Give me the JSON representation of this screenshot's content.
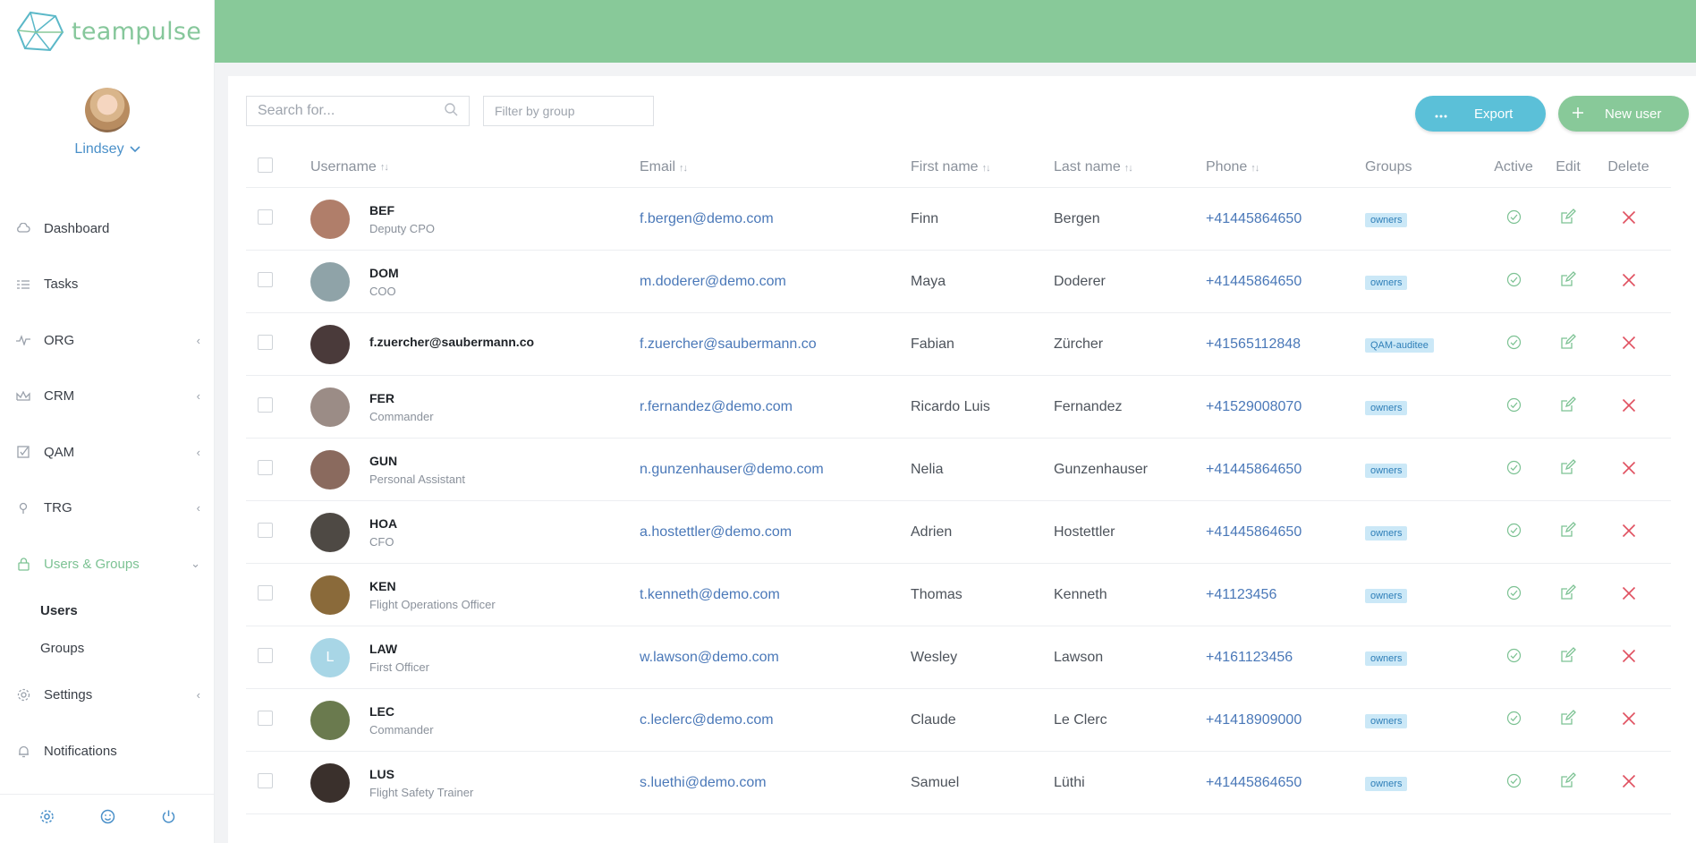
{
  "brand": {
    "name": "teampulse",
    "logo_icon": "hexagon-logo-icon"
  },
  "colors": {
    "header": "#88c999",
    "accent_green": "#7cc293",
    "link_blue": "#4a78b8",
    "export_button": "#5bc0d8",
    "delete_red": "#e05060",
    "badge_bg": "#cbe8f7"
  },
  "profile": {
    "name": "Lindsey"
  },
  "sidebar": {
    "items": [
      {
        "label": "Dashboard",
        "icon": "cloud-icon",
        "chevron": ""
      },
      {
        "label": "Tasks",
        "icon": "tasks-list-icon",
        "chevron": ""
      },
      {
        "label": "ORG",
        "icon": "pulse-icon",
        "chevron": "‹"
      },
      {
        "label": "CRM",
        "icon": "crown-icon",
        "chevron": "‹"
      },
      {
        "label": "QAM",
        "icon": "checkbox-icon",
        "chevron": "‹"
      },
      {
        "label": "TRG",
        "icon": "pin-icon",
        "chevron": "‹"
      },
      {
        "label": "Users & Groups",
        "icon": "lock-icon",
        "chevron": "⌄"
      }
    ],
    "subitems": [
      {
        "label": "Users"
      },
      {
        "label": "Groups"
      }
    ],
    "items_after": [
      {
        "label": "Settings",
        "icon": "gear-icon",
        "chevron": "‹"
      },
      {
        "label": "Notifications",
        "icon": "bell-icon",
        "chevron": ""
      }
    ],
    "footer_icons": [
      "settings-icon",
      "smiley-icon",
      "power-icon"
    ]
  },
  "toolbar": {
    "search_placeholder": "Search for...",
    "filter_placeholder": "Filter by group",
    "export_label": "Export",
    "new_user_label": "New user"
  },
  "table": {
    "headers": {
      "username": "Username",
      "email": "Email",
      "first_name": "First name",
      "last_name": "Last name",
      "phone": "Phone",
      "groups": "Groups",
      "active": "Active",
      "edit": "Edit",
      "delete": "Delete"
    },
    "rows": [
      {
        "abbr": "BEF",
        "role": "Deputy CPO",
        "email": "f.bergen@demo.com",
        "first": "Finn",
        "last": "Bergen",
        "phone": "+41445864650",
        "group": "owners",
        "avatar_color": "#b07e6a",
        "avatar_letter": ""
      },
      {
        "abbr": "DOM",
        "role": "COO",
        "email": "m.doderer@demo.com",
        "first": "Maya",
        "last": "Doderer",
        "phone": "+41445864650",
        "group": "owners",
        "avatar_color": "#8fa3a8",
        "avatar_letter": ""
      },
      {
        "abbr": "f.zuercher@saubermann.co",
        "role": "",
        "email": "f.zuercher@saubermann.co",
        "first": "Fabian",
        "last": "Zürcher",
        "phone": "+41565112848",
        "group": "QAM-auditee",
        "avatar_color": "#4a3a3a",
        "avatar_letter": ""
      },
      {
        "abbr": "FER",
        "role": "Commander",
        "email": "r.fernandez@demo.com",
        "first": "Ricardo Luis",
        "last": "Fernandez",
        "phone": "+41529008070",
        "group": "owners",
        "avatar_color": "#9b8c86",
        "avatar_letter": ""
      },
      {
        "abbr": "GUN",
        "role": "Personal Assistant",
        "email": "n.gunzenhauser@demo.com",
        "first": "Nelia",
        "last": "Gunzenhauser",
        "phone": "+41445864650",
        "group": "owners",
        "avatar_color": "#8a6a5e",
        "avatar_letter": ""
      },
      {
        "abbr": "HOA",
        "role": "CFO",
        "email": "a.hostettler@demo.com",
        "first": "Adrien",
        "last": "Hostettler",
        "phone": "+41445864650",
        "group": "owners",
        "avatar_color": "#4e4944",
        "avatar_letter": ""
      },
      {
        "abbr": "KEN",
        "role": "Flight Operations Officer",
        "email": "t.kenneth@demo.com",
        "first": "Thomas",
        "last": "Kenneth",
        "phone": "+41123456",
        "group": "owners",
        "avatar_color": "#8a6a3a",
        "avatar_letter": ""
      },
      {
        "abbr": "LAW",
        "role": "First Officer",
        "email": "w.lawson@demo.com",
        "first": "Wesley",
        "last": "Lawson",
        "phone": "+4161123456",
        "group": "owners",
        "avatar_color": "#a8d6e6",
        "avatar_letter": "L"
      },
      {
        "abbr": "LEC",
        "role": "Commander",
        "email": "c.leclerc@demo.com",
        "first": "Claude",
        "last": "Le Clerc",
        "phone": "+41418909000",
        "group": "owners",
        "avatar_color": "#6a7a4e",
        "avatar_letter": ""
      },
      {
        "abbr": "LUS",
        "role": "Flight Safety Trainer",
        "email": "s.luethi@demo.com",
        "first": "Samuel",
        "last": "Lüthi",
        "phone": "+41445864650",
        "group": "owners",
        "avatar_color": "#3a302c",
        "avatar_letter": ""
      }
    ]
  }
}
